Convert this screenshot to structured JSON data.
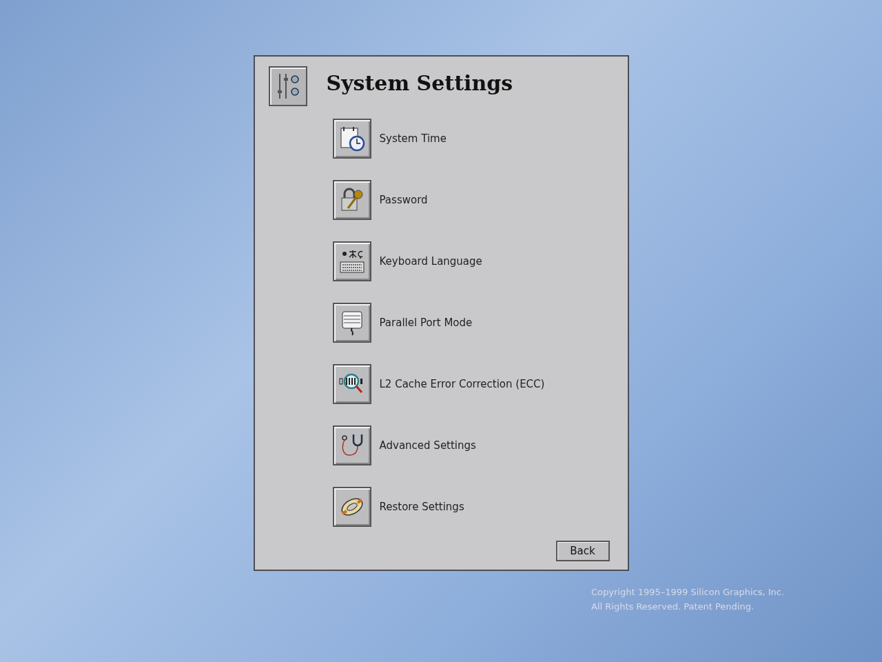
{
  "dialog": {
    "title": "System Settings",
    "items": [
      {
        "label": "System Time"
      },
      {
        "label": "Password"
      },
      {
        "label": "Keyboard Language"
      },
      {
        "label": "Parallel Port Mode"
      },
      {
        "label": "L2 Cache Error Correction (ECC)"
      },
      {
        "label": "Advanced Settings"
      },
      {
        "label": "Restore Settings"
      }
    ],
    "back_button": "Back"
  },
  "copyright": [
    "Copyright 1995–1999 Silicon Graphics, Inc.",
    "All Rights Reserved. Patent Pending."
  ]
}
